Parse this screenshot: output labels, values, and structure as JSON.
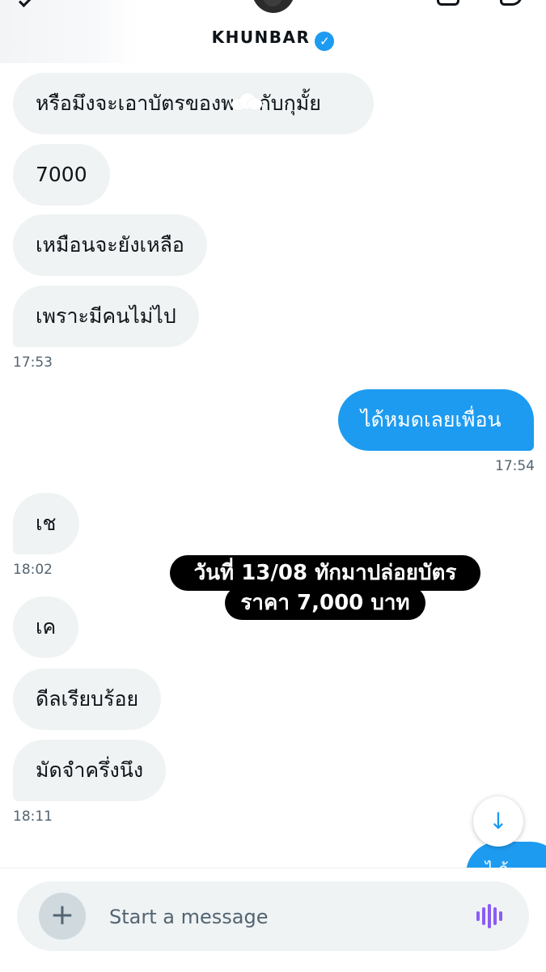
{
  "header": {
    "contact_name": "KHUNBAR",
    "verified_icon": "verified-badge-icon"
  },
  "messages": [
    {
      "id": "m1",
      "text_before": "หรือมึงจะเอาบัตรของพ",
      "text_after": "กับกุมั้ย",
      "has_cloud_sticker": true
    },
    {
      "id": "m2",
      "text": "7000"
    },
    {
      "id": "m3",
      "text": "เหมือนจะยังเหลือ"
    },
    {
      "id": "m4",
      "text": "เพราะมีคนไม่ไป",
      "time": "17:53"
    },
    {
      "id": "m5",
      "text": "ได้หมดเลยเพื่อน",
      "time": "17:54",
      "sent": true
    },
    {
      "id": "m6",
      "text": "เช",
      "time": "18:02"
    },
    {
      "id": "m7",
      "text": "เค"
    },
    {
      "id": "m8",
      "text": "ดีลเรียบร้อย"
    },
    {
      "id": "m9",
      "text": "มัดจำครึ่งนึง",
      "time": "18:11"
    }
  ],
  "overlay": {
    "line1": "วันที่ 13/08 ทักมาปล่อยบัตร",
    "line2": "ราคา 7,000 บาท"
  },
  "peek_message": "ไ ล้",
  "composer": {
    "placeholder": "Start a message",
    "add_icon": "plus-icon",
    "voice_icon": "voice-wave-icon"
  },
  "scroll_button_icon": "arrow-down-icon",
  "colors": {
    "accent": "#1d9bf0",
    "received_bubble": "#eff3f4",
    "overlay_bg": "#000000",
    "voice_icon": "#8b5cf6"
  }
}
